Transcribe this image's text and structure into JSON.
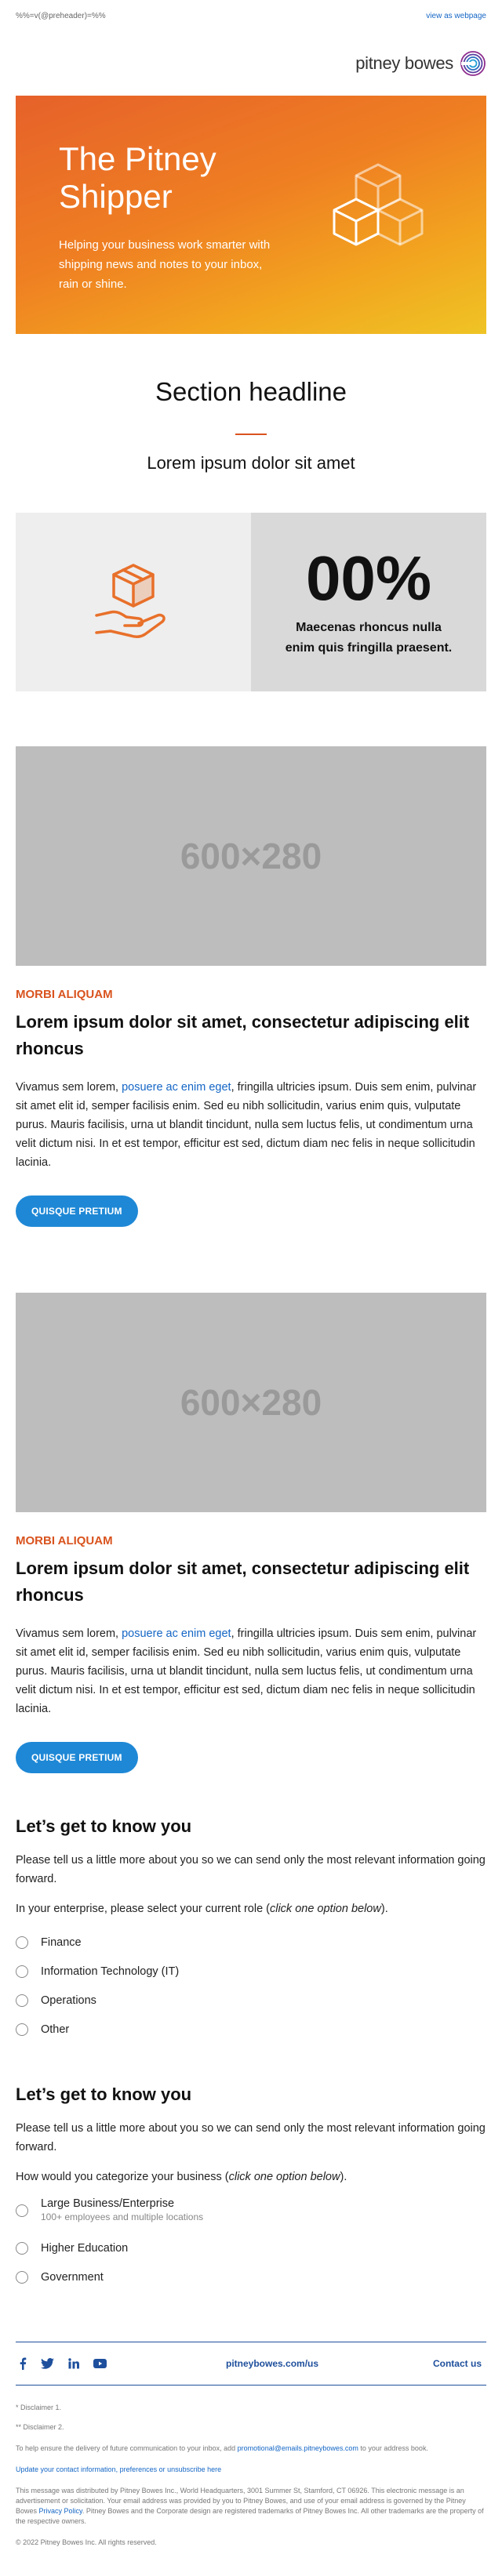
{
  "preheader": {
    "text": "%%=v(@preheader)=%%",
    "view_link": "view as webpage"
  },
  "brand": {
    "logo_text": "pitney bowes"
  },
  "hero": {
    "title_line1": "The Pitney",
    "title_line2": "Shipper",
    "subtitle": "Helping your business work smarter with shipping news and notes to your inbox, rain or shine."
  },
  "section": {
    "headline": "Section headline",
    "subheadline": "Lorem ipsum dolor sit amet"
  },
  "stat": {
    "number": "00%",
    "caption": "Maecenas rhoncus nulla enim quis fringilla praesent."
  },
  "articles": [
    {
      "image_placeholder": "600×280",
      "eyebrow": "MORBI ALIQUAM",
      "title": "Lorem ipsum dolor sit amet, consectetur adipiscing elit rhoncus",
      "body_before_link": "Vivamus sem lorem, ",
      "body_link": "posuere ac enim eget",
      "body_after_link": ", fringilla ultricies ipsum. Duis sem enim, pulvinar sit amet elit id, semper facilisis enim. Sed eu nibh sollicitudin, varius enim quis, vulputate purus. Mauris facilisis, urna ut blandit tincidunt, nulla sem luctus felis, ut condimentum urna velit dictum nisi. In et est tempor, efficitur est sed, dictum diam nec felis in neque sollicitudin lacinia.",
      "cta": "QUISQUE PRETIUM"
    },
    {
      "image_placeholder": "600×280",
      "eyebrow": "MORBI ALIQUAM",
      "title": "Lorem ipsum dolor sit amet, consectetur adipiscing elit rhoncus",
      "body_before_link": "Vivamus sem lorem, ",
      "body_link": "posuere ac enim eget",
      "body_after_link": ", fringilla ultricies ipsum. Duis sem enim, pulvinar sit amet elit id, semper facilisis enim. Sed eu nibh sollicitudin, varius enim quis, vulputate purus. Mauris facilisis, urna ut blandit tincidunt, nulla sem luctus felis, ut condimentum urna velit dictum nisi. In et est tempor, efficitur est sed, dictum diam nec felis in neque sollicitudin lacinia.",
      "cta": "QUISQUE PRETIUM"
    }
  ],
  "survey1": {
    "title": "Let’s get to know you",
    "intro": "Please tell us a little more about you so we can send only the most relevant information going forward.",
    "question_before": "In your enterprise, please select your current role (",
    "question_em": "click one option below",
    "question_after": ").",
    "options": [
      "Finance",
      "Information Technology (IT)",
      "Operations",
      "Other"
    ]
  },
  "survey2": {
    "title": "Let’s get to know you",
    "intro": "Please tell us a little more about you so we can send only the most relevant information going forward.",
    "question_before": "How would you categorize your business (",
    "question_em": "click one option below",
    "question_after": ").",
    "options": [
      {
        "label": "Large Business/Enterprise",
        "hint": "100+ employees and multiple locations"
      },
      {
        "label": "Higher Education",
        "hint": ""
      },
      {
        "label": "Government",
        "hint": ""
      }
    ]
  },
  "footer": {
    "site_link": "pitneybowes.com/us",
    "contact_link": "Contact us",
    "social_icons": [
      "facebook-icon",
      "twitter-icon",
      "linkedin-icon",
      "youtube-icon"
    ]
  },
  "legal": {
    "disclaimer1": "* Disclaimer 1.",
    "disclaimer2": "** Disclaimer 2.",
    "delivery_before": "To help ensure the delivery of future communication to your inbox, add ",
    "delivery_email": "promotional@emails.pitneybowes.com",
    "delivery_after": " to your address book.",
    "preferences_link": "Update your contact information, preferences or unsubscribe here",
    "distribution_before": "This message was distributed by Pitney Bowes Inc., World Headquarters, 3001 Summer St, Stamford, CT 06926. This electronic message is an advertisement or solicitation. Your email address was provided by you to Pitney Bowes, and use of your email address is governed by the Pitney Bowes ",
    "privacy_link": "Privacy Policy",
    "distribution_after": ". Pitney Bowes and the Corporate design are registered trademarks of Pitney Bowes Inc. All other trademarks are the property of the respective owners.",
    "copyright": "© 2022 Pitney Bowes Inc. All rights reserved."
  },
  "colors": {
    "accent_orange": "#d9531e",
    "link_blue": "#1466c5",
    "cta_blue": "#1e88d6",
    "footer_navy": "#1e4f9c"
  }
}
